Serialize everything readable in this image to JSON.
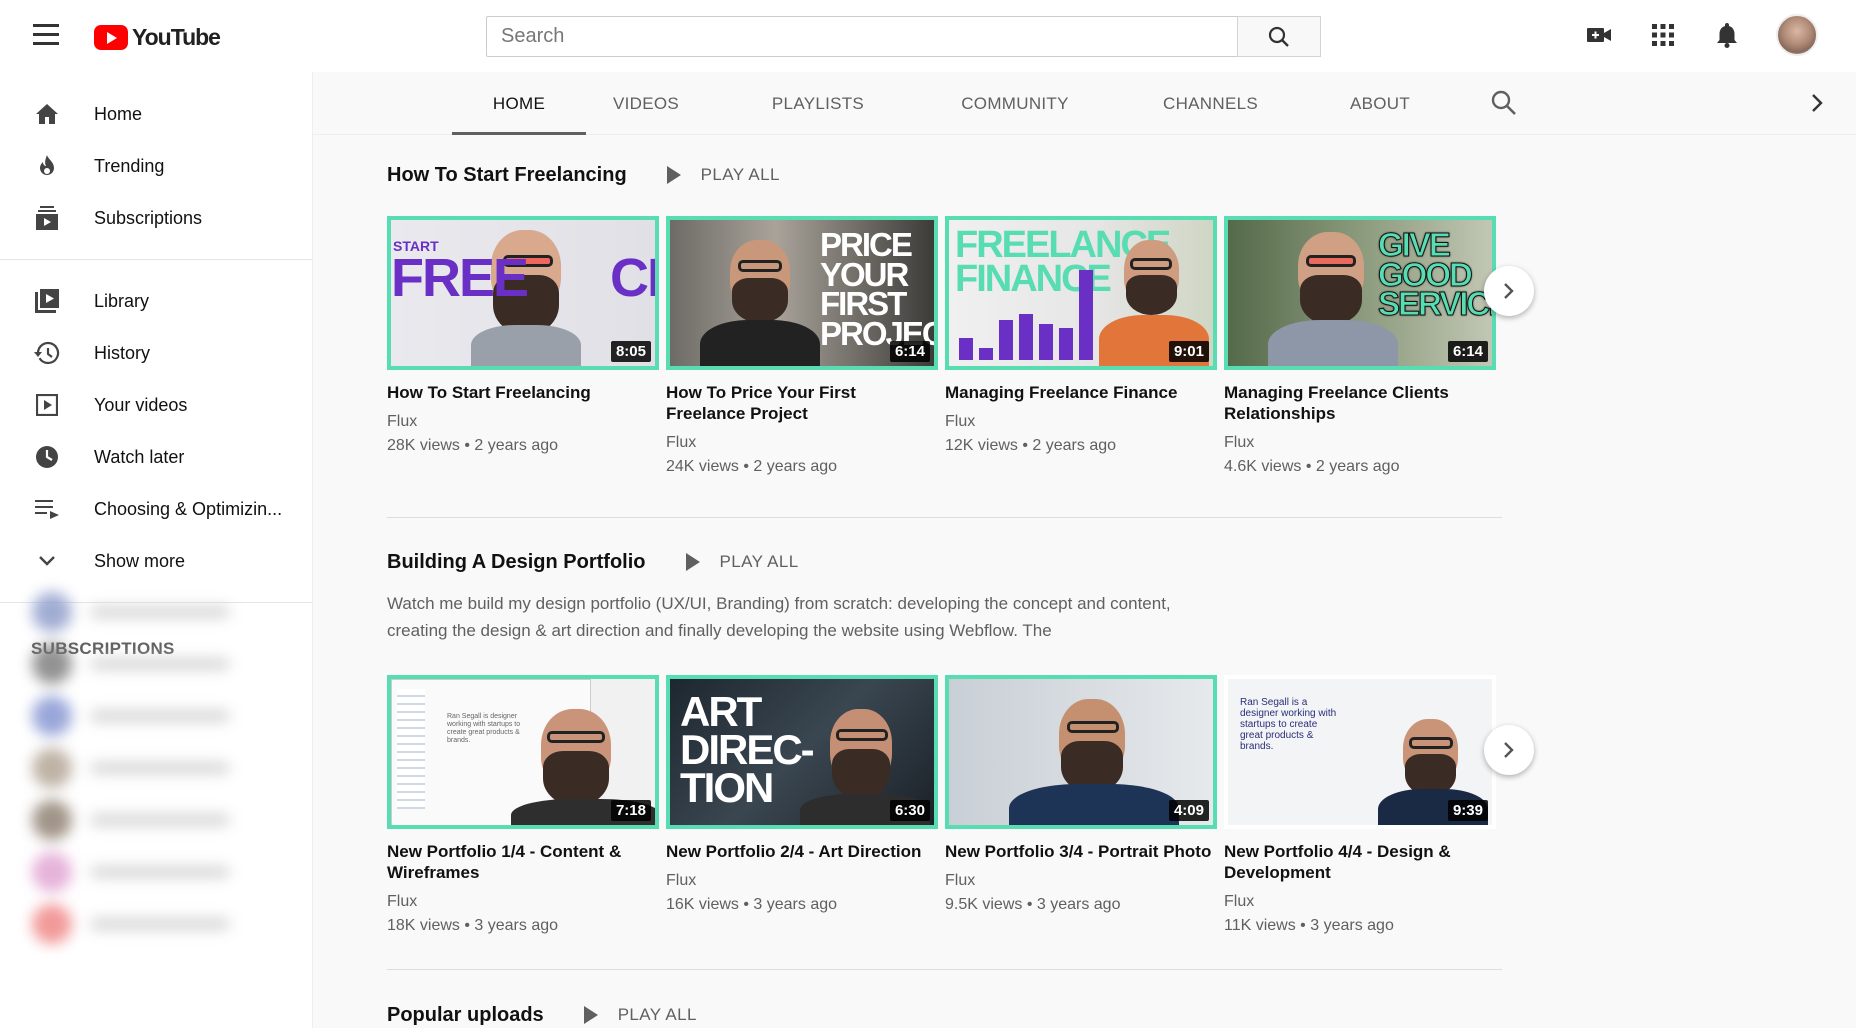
{
  "header": {
    "logo_text": "YouTube",
    "search_placeholder": "Search"
  },
  "sidebar": {
    "main": [
      {
        "label": "Home",
        "icon": "home-icon"
      },
      {
        "label": "Trending",
        "icon": "flame-icon"
      },
      {
        "label": "Subscriptions",
        "icon": "subscriptions-icon"
      }
    ],
    "library": [
      {
        "label": "Library",
        "icon": "library-icon"
      },
      {
        "label": "History",
        "icon": "history-icon"
      },
      {
        "label": "Your videos",
        "icon": "your-videos-icon"
      },
      {
        "label": "Watch later",
        "icon": "clock-icon"
      },
      {
        "label": "Choosing & Optimizin...",
        "icon": "playlist-icon"
      },
      {
        "label": "Show more",
        "icon": "chevron-down-icon"
      }
    ],
    "subscriptions_title": "SUBSCRIPTIONS"
  },
  "tabs": [
    "HOME",
    "VIDEOS",
    "PLAYLISTS",
    "COMMUNITY",
    "CHANNELS",
    "ABOUT"
  ],
  "active_tab": "HOME",
  "shelves": [
    {
      "title": "How To Start Freelancing",
      "play_all": "PLAY ALL",
      "description": "",
      "videos": [
        {
          "title": "How To Start Freelancing",
          "channel": "Flux",
          "meta": "28K views • 2 years ago",
          "duration": "8:05"
        },
        {
          "title": "How To Price Your First Freelance Project",
          "channel": "Flux",
          "meta": "24K views • 2 years ago",
          "duration": "6:14"
        },
        {
          "title": "Managing Freelance Finance",
          "channel": "Flux",
          "meta": "12K views • 2 years ago",
          "duration": "9:01"
        },
        {
          "title": "Managing Freelance Clients Relationships",
          "channel": "Flux",
          "meta": "4.6K views • 2 years ago",
          "duration": "6:14"
        }
      ]
    },
    {
      "title": "Building A Design Portfolio",
      "play_all": "PLAY ALL",
      "description": "Watch me build my design portfolio (UX/UI, Branding) from scratch: developing the concept and content, creating the design & art direction and finally developing the website using Webflow. The",
      "videos": [
        {
          "title": "New Portfolio 1/4 - Content & Wireframes",
          "channel": "Flux",
          "meta": "18K views • 3 years ago",
          "duration": "7:18"
        },
        {
          "title": "New Portfolio 2/4 - Art Direction",
          "channel": "Flux",
          "meta": "16K views • 3 years ago",
          "duration": "6:30"
        },
        {
          "title": "New Portfolio 3/4 - Portrait Photo",
          "channel": "Flux",
          "meta": "9.5K views • 3 years ago",
          "duration": "4:09"
        },
        {
          "title": "New Portfolio 4/4 - Design & Development",
          "channel": "Flux",
          "meta": "11K views • 3 years ago",
          "duration": "9:39"
        }
      ]
    },
    {
      "title": "Popular uploads",
      "play_all": "PLAY ALL"
    }
  ],
  "thumb_text": {
    "t1_small": "START",
    "t1_big": "FREE CING",
    "t2": "PRICE YOUR FIRST PROJECT",
    "t3": "FREELANCE FINANCE",
    "t4": "GIVE GOOD SERVICE",
    "t5": "Ran Segall is designer working with startups to create great products & brands.",
    "t6": "ART DIREC- TION",
    "t8": "Ran Segall is a designer working with startups to create great products & brands."
  },
  "colors": {
    "accent_border": "#58dcb2",
    "brand_red": "#ff0000",
    "thumb_purple": "#6a2fc4"
  }
}
